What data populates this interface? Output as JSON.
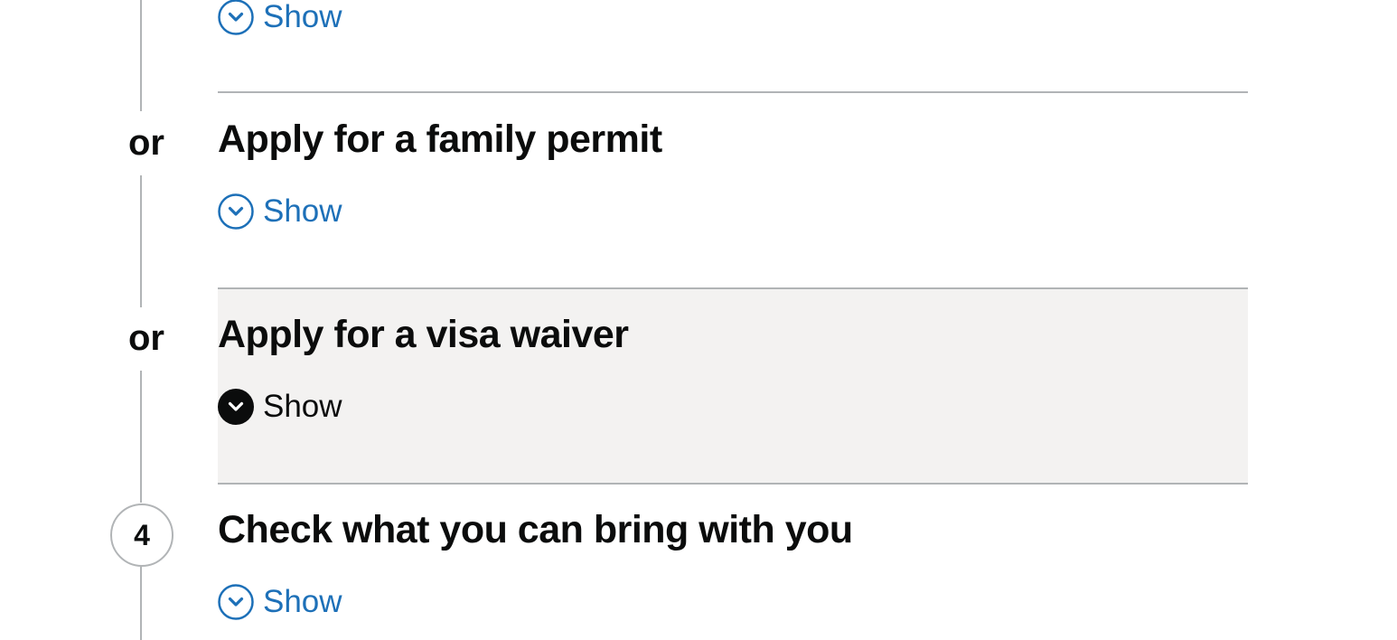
{
  "steps": {
    "top_section": {
      "toggle_label": "Show"
    },
    "family_permit": {
      "connector": "or",
      "title": "Apply for a family permit",
      "toggle_label": "Show"
    },
    "visa_waiver": {
      "connector": "or",
      "title": "Apply for a visa waiver",
      "toggle_label": "Show",
      "state": "hovered"
    },
    "bring_with_you": {
      "number": "4",
      "title": "Check what you can bring with you",
      "toggle_label": "Show"
    }
  },
  "colors": {
    "link": "#1d70b8",
    "text": "#0b0c0c",
    "line": "#b1b4b6",
    "hover_background": "#f3f2f1"
  },
  "icons": {
    "toggle": "chevron-down-circle-icon"
  }
}
